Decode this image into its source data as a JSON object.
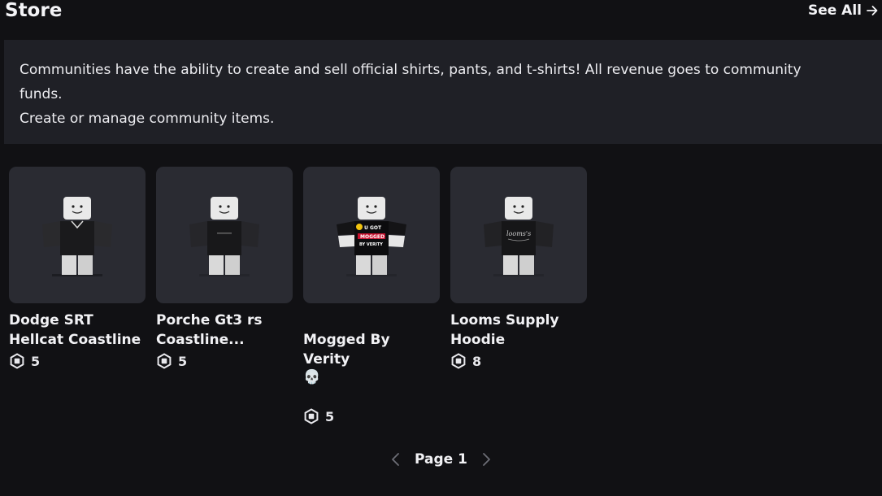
{
  "header": {
    "title": "Store",
    "see_all_label": "See All"
  },
  "info": {
    "line1": "Communities have the ability to create and sell official shirts, pants, and t-shirts! All revenue goes to community funds.",
    "line2": "Create or manage community items."
  },
  "items": [
    {
      "name": "Dodge SRT\nHellcat Coastline",
      "price": "5",
      "shirt_text": ""
    },
    {
      "name": "Porche Gt3 rs\nCoastline...",
      "price": "5",
      "shirt_text": ""
    },
    {
      "name": "Mogged By Verity",
      "emoji": "💀",
      "price": "5",
      "shirt_text": "U GOT MOGGED BY VERITY"
    },
    {
      "name": "Looms Supply\nHoodie",
      "price": "8",
      "shirt_text": "looms's"
    }
  ],
  "pager": {
    "label": "Page 1"
  },
  "colors": {
    "background": "#111114",
    "panel": "#1f2026",
    "card": "#2a2b32"
  },
  "icons": {
    "currency": "robux-icon",
    "prev": "chevron-left-icon",
    "next": "chevron-right-icon",
    "see_all": "arrow-right-icon"
  }
}
